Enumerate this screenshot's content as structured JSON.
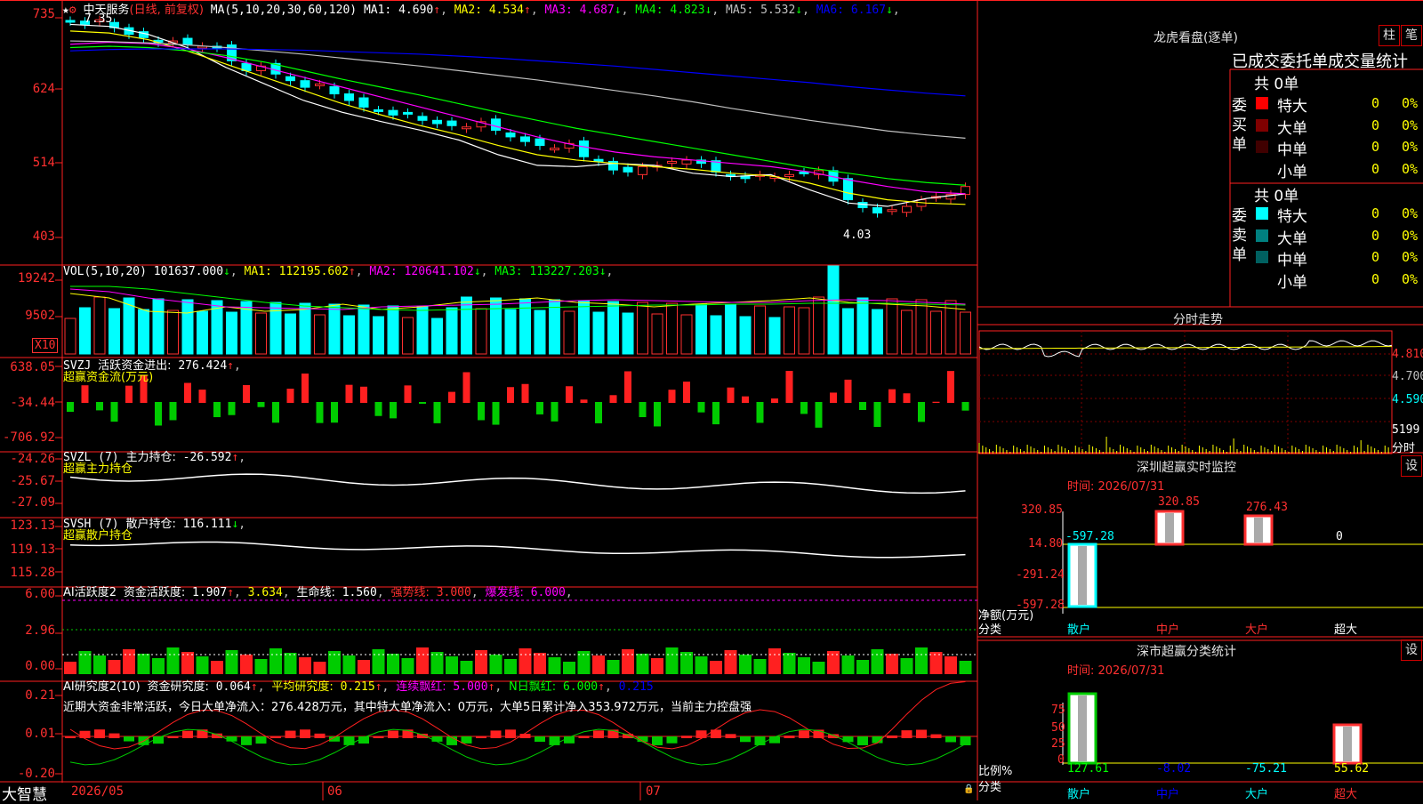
{
  "stock": {
    "name": "中天服务",
    "period": "(日线, 前复权)",
    "high_mark": "7.35",
    "low_mark": "4.03"
  },
  "ma_line": {
    "label": "MA(5,10,20,30,60,120)",
    "items": [
      {
        "name": "MA1",
        "value": "4.690",
        "arrow": "↑",
        "color": "#ffffff"
      },
      {
        "name": "MA2",
        "value": "4.534",
        "arrow": "↑",
        "color": "#ffff00"
      },
      {
        "name": "MA3",
        "value": "4.687",
        "arrow": "↓",
        "color": "#ff00ff"
      },
      {
        "name": "MA4",
        "value": "4.823",
        "arrow": "↓",
        "color": "#00ff00"
      },
      {
        "name": "MA5",
        "value": "5.532",
        "arrow": "↓",
        "color": "#c0c0c0"
      },
      {
        "name": "MA6",
        "value": "6.167",
        "arrow": "↓",
        "color": "#0000ff"
      }
    ]
  },
  "price_axis": [
    "735",
    "624",
    "514",
    "403"
  ],
  "volume": {
    "label": "VOL(5,10,20)",
    "value": "101637.000",
    "arrow": "↓",
    "items": [
      {
        "name": "MA1",
        "value": "112195.602",
        "arrow": "↑",
        "color": "#ffff00"
      },
      {
        "name": "MA2",
        "value": "120641.102",
        "arrow": "↓",
        "color": "#ff00ff"
      },
      {
        "name": "MA3",
        "value": "113227.203",
        "arrow": "↓",
        "color": "#00ff00"
      }
    ],
    "axis": [
      "19242",
      "9502"
    ],
    "multiplier": "X10"
  },
  "svzj": {
    "label": "SVZJ",
    "title": "活跃资金进出:",
    "value": "276.424",
    "arrow": "↑",
    "sub": "超赢资金流(万元)",
    "axis": [
      "638.05",
      "-34.44",
      "-706.92"
    ]
  },
  "svzl": {
    "label": "SVZL (7)",
    "title": "主力持仓:",
    "value": "-26.592",
    "arrow": "↑",
    "sub": "超赢主力持仓",
    "axis": [
      "-24.26",
      "-25.67",
      "-27.09"
    ]
  },
  "svsh": {
    "label": "SVSH (7)",
    "title": "散户持仓:",
    "value": "116.111",
    "arrow": "↓",
    "sub": "超赢散户持仓",
    "axis": [
      "123.13",
      "119.13",
      "115.28"
    ]
  },
  "ai_active": {
    "label": "AI活跃度2",
    "title": "资金活跃度:",
    "value": "1.907",
    "arrow": "↑",
    "value2": "3.634",
    "life_label": "生命线:",
    "life": "1.560",
    "strong_label": "强势线:",
    "strong": "3.000",
    "burst_label": "爆发线:",
    "burst": "6.000",
    "axis": [
      "6.00",
      "2.96",
      "0.00"
    ]
  },
  "ai_research": {
    "label": "AI研究度2(10)",
    "title": "资金研究度:",
    "value": "0.064",
    "arrow": "↑",
    "avg_label": "平均研究度:",
    "avg": "0.215",
    "avg_arrow": "↑",
    "red_label": "连续飘红:",
    "red": "5.000",
    "red_arrow": "↑",
    "nred_label": "N日飘红:",
    "nred": "6.000",
    "nred_arrow": "↑",
    "tail": "0.215",
    "comment": "近期大资金非常活跃，今日大单净流入：276.428万元，其中特大单净流入：0万元，大单5日累计净入353.972万元，当前主力控盘强",
    "axis": [
      "0.21",
      "0.01",
      "-0.20"
    ]
  },
  "bottom": {
    "brand": "大智慧",
    "dates": [
      "2026/05",
      "06",
      "07"
    ]
  },
  "dragon": {
    "title": "龙虎看盘(逐单)",
    "tab1": "柱",
    "tab2": "笔",
    "header": "已成交委托单成交量统计",
    "buy": {
      "side": "委买单",
      "total": "共 0单",
      "rows": [
        {
          "label": "特大",
          "qty": "0",
          "pct": "0%",
          "color": "#ff0000"
        },
        {
          "label": "大单",
          "qty": "0",
          "pct": "0%",
          "color": "#800000"
        },
        {
          "label": "中单",
          "qty": "0",
          "pct": "0%",
          "color": "#400000"
        },
        {
          "label": "小单",
          "qty": "0",
          "pct": "0%",
          "color": "#000000"
        }
      ]
    },
    "sell": {
      "side": "委卖单",
      "total": "共 0单",
      "rows": [
        {
          "label": "特大",
          "qty": "0",
          "pct": "0%",
          "color": "#00ffff"
        },
        {
          "label": "大单",
          "qty": "0",
          "pct": "0%",
          "color": "#008080"
        },
        {
          "label": "中单",
          "qty": "0",
          "pct": "0%",
          "color": "#006060"
        },
        {
          "label": "小单",
          "qty": "0",
          "pct": "0%",
          "color": "#000000"
        }
      ]
    }
  },
  "intraday": {
    "title": "分时走势",
    "axis": [
      "4.810",
      "4.700",
      "4.590"
    ],
    "vol_axis": "5199",
    "vol_unit": "分时"
  },
  "sz_monitor": {
    "title": "深圳超赢实时监控",
    "gear": "设",
    "time": "时间: 2026/07/31",
    "axis": [
      "320.85",
      "14.80",
      "-291.24",
      "-597.28"
    ],
    "y_label": "净额(万元)",
    "x_label": "分类",
    "categories": [
      "散户",
      "中户",
      "大户",
      "超大"
    ],
    "values": [
      "-597.28",
      "320.85",
      "276.43",
      "0"
    ]
  },
  "sz_class": {
    "title": "深市超赢分类统计",
    "gear": "设",
    "time": "时间: 2026/07/31",
    "axis": [
      "75",
      "50",
      "25",
      "0"
    ],
    "y_label": "比例%",
    "x_label": "分类",
    "categories": [
      "散户",
      "中户",
      "大户",
      "超大"
    ],
    "values": [
      "127.61",
      "-8.02",
      "-75.21",
      "55.62"
    ]
  },
  "chart_data": [
    {
      "type": "line",
      "title": "中天服务 (日线, 前复权)",
      "ylim": [
        4.03,
        7.35
      ],
      "series": [
        {
          "name": "MA1",
          "values": [
            4.69
          ]
        },
        {
          "name": "MA2",
          "values": [
            4.534
          ]
        },
        {
          "name": "MA3",
          "values": [
            4.687
          ]
        },
        {
          "name": "MA4",
          "values": [
            4.823
          ]
        },
        {
          "name": "MA5",
          "values": [
            5.532
          ]
        },
        {
          "name": "MA6",
          "values": [
            6.167
          ]
        }
      ]
    },
    {
      "type": "bar",
      "title": "深圳超赢实时监控",
      "categories": [
        "散户",
        "中户",
        "大户",
        "超大"
      ],
      "values": [
        -597.28,
        320.85,
        276.43,
        0
      ],
      "ylabel": "净额(万元)"
    },
    {
      "type": "bar",
      "title": "深市超赢分类统计",
      "categories": [
        "散户",
        "中户",
        "大户",
        "超大"
      ],
      "values": [
        127.61,
        -8.02,
        -75.21,
        55.62
      ],
      "ylabel": "比例%"
    }
  ]
}
